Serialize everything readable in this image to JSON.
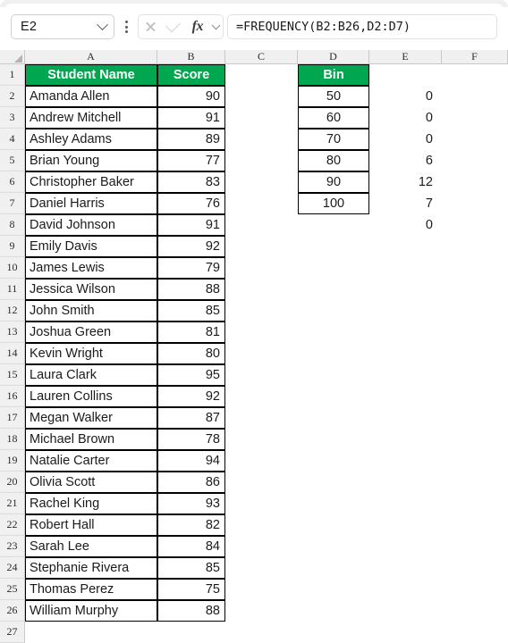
{
  "name_box": {
    "value": "E2"
  },
  "formula_bar": {
    "value": "=FREQUENCY(B2:B26,D2:D7)",
    "cancel_icon": "close-icon",
    "enter_icon": "check-icon",
    "function_icon": "fx-icon",
    "expand_icon": "chevron-down-icon"
  },
  "grid": {
    "column_headers": [
      "A",
      "B",
      "C",
      "D",
      "E",
      "F"
    ],
    "row_headers": [
      "1",
      "2",
      "3",
      "4",
      "5",
      "6",
      "7",
      "8",
      "9",
      "10",
      "11",
      "12",
      "13",
      "14",
      "15",
      "16",
      "17",
      "18",
      "19",
      "20",
      "21",
      "22",
      "23",
      "24",
      "25",
      "26",
      "27"
    ],
    "headers": {
      "student_name": "Student Name",
      "score": "Score",
      "bin": "Bin"
    },
    "accent_color": "#00a650",
    "students": [
      {
        "row": "2",
        "name": "Amanda Allen",
        "score": "90"
      },
      {
        "row": "3",
        "name": "Andrew Mitchell",
        "score": "91"
      },
      {
        "row": "4",
        "name": "Ashley Adams",
        "score": "89"
      },
      {
        "row": "5",
        "name": "Brian Young",
        "score": "77"
      },
      {
        "row": "6",
        "name": "Christopher Baker",
        "score": "83"
      },
      {
        "row": "7",
        "name": "Daniel Harris",
        "score": "76"
      },
      {
        "row": "8",
        "name": "David Johnson",
        "score": "91"
      },
      {
        "row": "9",
        "name": "Emily Davis",
        "score": "92"
      },
      {
        "row": "10",
        "name": "James Lewis",
        "score": "79"
      },
      {
        "row": "11",
        "name": "Jessica Wilson",
        "score": "88"
      },
      {
        "row": "12",
        "name": "John Smith",
        "score": "85"
      },
      {
        "row": "13",
        "name": "Joshua Green",
        "score": "81"
      },
      {
        "row": "14",
        "name": "Kevin Wright",
        "score": "80"
      },
      {
        "row": "15",
        "name": "Laura Clark",
        "score": "95"
      },
      {
        "row": "16",
        "name": "Lauren Collins",
        "score": "92"
      },
      {
        "row": "17",
        "name": "Megan Walker",
        "score": "87"
      },
      {
        "row": "18",
        "name": "Michael Brown",
        "score": "78"
      },
      {
        "row": "19",
        "name": "Natalie Carter",
        "score": "94"
      },
      {
        "row": "20",
        "name": "Olivia Scott",
        "score": "86"
      },
      {
        "row": "21",
        "name": "Rachel King",
        "score": "93"
      },
      {
        "row": "22",
        "name": "Robert Hall",
        "score": "82"
      },
      {
        "row": "23",
        "name": "Sarah Lee",
        "score": "84"
      },
      {
        "row": "24",
        "name": "Stephanie Rivera",
        "score": "85"
      },
      {
        "row": "25",
        "name": "Thomas Perez",
        "score": "75"
      },
      {
        "row": "26",
        "name": "William Murphy",
        "score": "88"
      }
    ],
    "bins": [
      {
        "row": "2",
        "bin": "50",
        "frequency": "0"
      },
      {
        "row": "3",
        "bin": "60",
        "frequency": "0"
      },
      {
        "row": "4",
        "bin": "70",
        "frequency": "0"
      },
      {
        "row": "5",
        "bin": "80",
        "frequency": "6"
      },
      {
        "row": "6",
        "bin": "90",
        "frequency": "12"
      },
      {
        "row": "7",
        "bin": "100",
        "frequency": "7"
      }
    ],
    "overflow_frequency": {
      "row": "8",
      "frequency": "0"
    }
  }
}
